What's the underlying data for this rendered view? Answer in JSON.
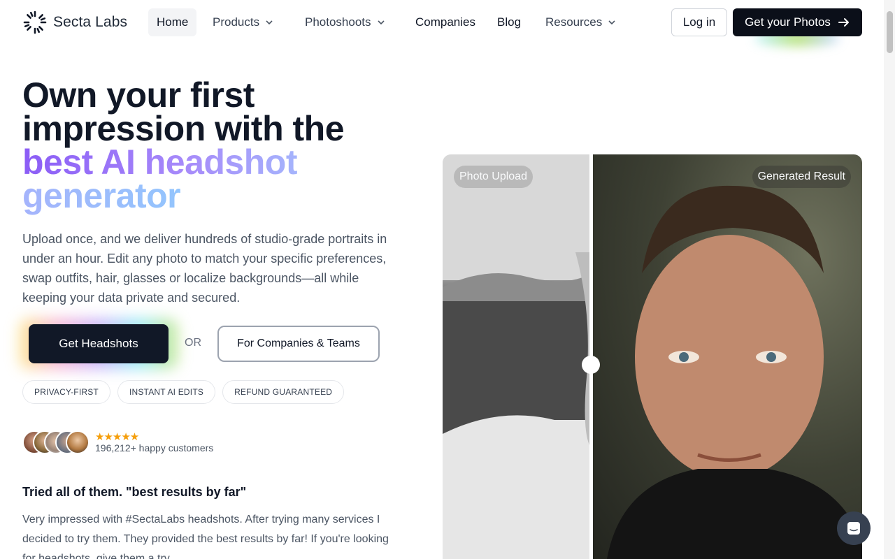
{
  "nav": {
    "logo_text": "Secta Labs",
    "items": [
      {
        "label": "Home"
      },
      {
        "label": "Products"
      },
      {
        "label": "Photoshoots"
      },
      {
        "label": "Companies"
      },
      {
        "label": "Blog"
      },
      {
        "label": "Resources"
      }
    ],
    "login_label": "Log in",
    "cta_label": "Get your Photos"
  },
  "hero": {
    "title_line1": "Own your first",
    "title_line2": "impression with the",
    "title_highlight1": "best AI headshot",
    "title_highlight2": "generator",
    "subtitle": "Upload once, and we deliver hundreds of studio-grade portraits in under an hour. Edit any photo to match your specific preferences, swap outfits, hair, glasses or localize backgrounds—all while keeping your data private and secured.",
    "primary_cta": "Get Headshots",
    "or_text": "OR",
    "secondary_cta": "For Companies & Teams",
    "tags": [
      "PRIVACY-FIRST",
      "INSTANT AI EDITS",
      "REFUND GUARANTEED"
    ],
    "stars": "★★★★★",
    "customers_text": "196,212+ happy customers"
  },
  "testimonial": {
    "title": "Tried all of them. \"best results by far\"",
    "body": "Very impressed with #SectaLabs headshots. After trying many services I decided to try them. They provided the best results by far! If you're looking for headshots, give them a try."
  },
  "compare": {
    "left_label": "Photo Upload",
    "right_label": "Generated Result"
  },
  "colors": {
    "primary_dark": "#111827",
    "accent_purple": "#8b5cf6",
    "accent_blue": "#93c5fd",
    "star": "#f59e0b"
  }
}
